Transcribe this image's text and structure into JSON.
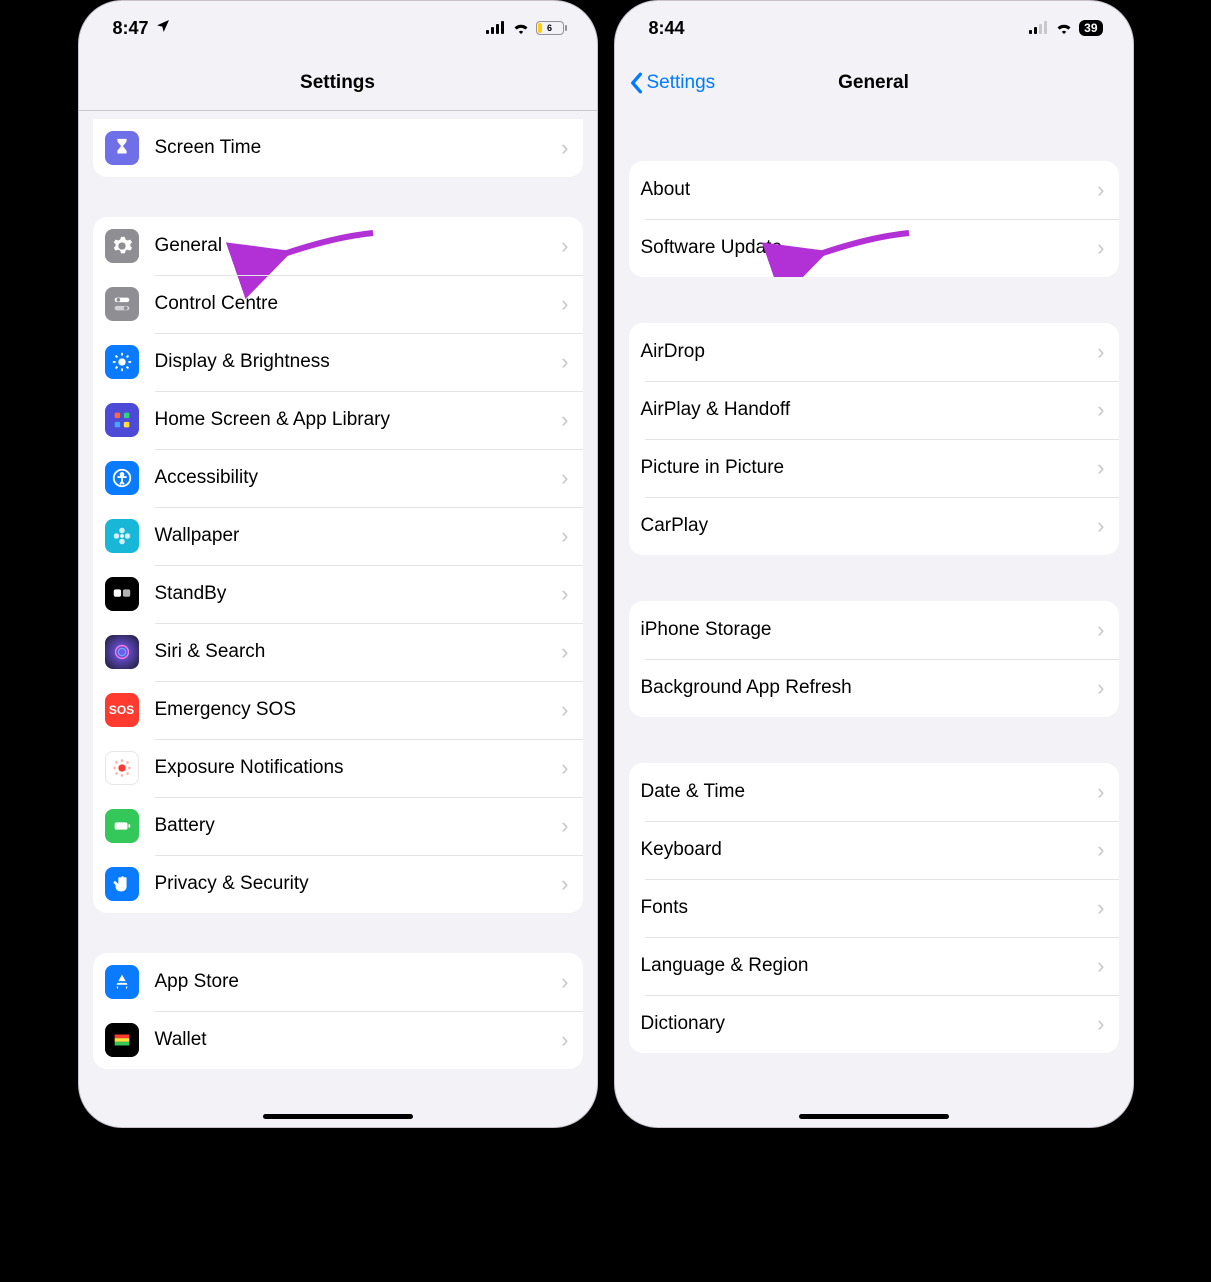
{
  "left": {
    "status": {
      "time": "8:47",
      "battery_num": "6"
    },
    "nav": {
      "title": "Settings"
    },
    "group0": [
      {
        "key": "screentime",
        "label": "Screen Time"
      }
    ],
    "group1": [
      {
        "key": "general",
        "label": "General"
      },
      {
        "key": "controlcentre",
        "label": "Control Centre"
      },
      {
        "key": "display",
        "label": "Display & Brightness"
      },
      {
        "key": "homescreen",
        "label": "Home Screen & App Library"
      },
      {
        "key": "accessibility",
        "label": "Accessibility"
      },
      {
        "key": "wallpaper",
        "label": "Wallpaper"
      },
      {
        "key": "standby",
        "label": "StandBy"
      },
      {
        "key": "siri",
        "label": "Siri & Search"
      },
      {
        "key": "sos",
        "label": "Emergency SOS"
      },
      {
        "key": "exposure",
        "label": "Exposure Notifications"
      },
      {
        "key": "battery",
        "label": "Battery"
      },
      {
        "key": "privacy",
        "label": "Privacy & Security"
      }
    ],
    "group2": [
      {
        "key": "appstore",
        "label": "App Store"
      },
      {
        "key": "wallet",
        "label": "Wallet"
      }
    ]
  },
  "right": {
    "status": {
      "time": "8:44",
      "battery_num": "39"
    },
    "nav": {
      "back": "Settings",
      "title": "General"
    },
    "group0": [
      {
        "key": "about",
        "label": "About"
      },
      {
        "key": "software",
        "label": "Software Update"
      }
    ],
    "group1": [
      {
        "key": "airdrop",
        "label": "AirDrop"
      },
      {
        "key": "airplay",
        "label": "AirPlay & Handoff"
      },
      {
        "key": "pip",
        "label": "Picture in Picture"
      },
      {
        "key": "carplay",
        "label": "CarPlay"
      }
    ],
    "group2": [
      {
        "key": "storage",
        "label": "iPhone Storage"
      },
      {
        "key": "bgrefresh",
        "label": "Background App Refresh"
      }
    ],
    "group3": [
      {
        "key": "datetime",
        "label": "Date & Time"
      },
      {
        "key": "keyboard",
        "label": "Keyboard"
      },
      {
        "key": "fonts",
        "label": "Fonts"
      },
      {
        "key": "langregion",
        "label": "Language & Region"
      },
      {
        "key": "dictionary",
        "label": "Dictionary"
      }
    ]
  },
  "colors": {
    "screentime": "#6f6fe8",
    "general": "#8e8e93",
    "controlcentre": "#8e8e93",
    "display": "#0a7aff",
    "homescreen": "#4c4ad6",
    "accessibility": "#0a7aff",
    "wallpaper": "#18b7d8",
    "standby": "#000000",
    "siri": "#1c1b2e",
    "sos": "#ff3b30",
    "exposure": "#ffffff",
    "battery": "#34c759",
    "privacy": "#0a7aff",
    "appstore": "#0a7aff",
    "wallet": "#000000"
  }
}
